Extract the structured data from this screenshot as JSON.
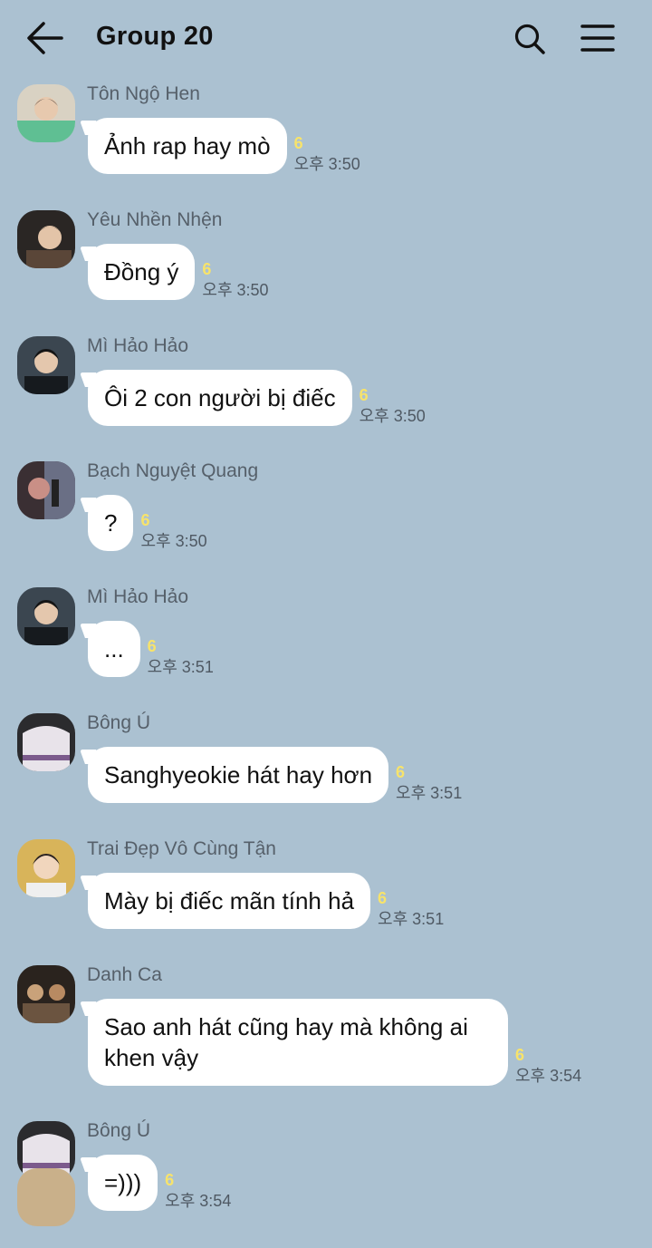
{
  "header": {
    "title": "Group 20",
    "back_icon": "arrow-left-icon",
    "search_icon": "search-icon",
    "menu_icon": "hamburger-menu-icon"
  },
  "messages": [
    {
      "sender": "Tôn Ngộ Hen",
      "text": "Ảnh rap hay mò",
      "unread": "6",
      "time": "오후 3:50"
    },
    {
      "sender": "Yêu Nhền Nhện",
      "text": "Đồng ý",
      "unread": "6",
      "time": "오후 3:50"
    },
    {
      "sender": "Mì Hảo Hảo",
      "text": "Ôi 2 con người bị điếc",
      "unread": "6",
      "time": "오후 3:50"
    },
    {
      "sender": "Bạch Nguyệt Quang",
      "text": "?",
      "unread": "6",
      "time": "오후 3:50"
    },
    {
      "sender": "Mì Hảo Hảo",
      "text": "...",
      "unread": "6",
      "time": "오후 3:51"
    },
    {
      "sender": "Bông Ú",
      "text": "Sanghyeokie hát hay hơn",
      "unread": "6",
      "time": "오후 3:51"
    },
    {
      "sender": "Trai Đẹp Vô Cùng Tận",
      "text": "Mày bị điếc mãn tính hả",
      "unread": "6",
      "time": "오후 3:51"
    },
    {
      "sender": "Danh Ca",
      "text": "Sao anh hát cũng hay mà không ai khen vậy",
      "unread": "6",
      "time": "오후 3:54"
    },
    {
      "sender": "Bông Ú",
      "text": "=)))",
      "unread": "6",
      "time": "오후 3:54"
    }
  ],
  "colors": {
    "background": "#abc1d1",
    "bubble": "#ffffff",
    "unread_count": "#f7e36b"
  }
}
